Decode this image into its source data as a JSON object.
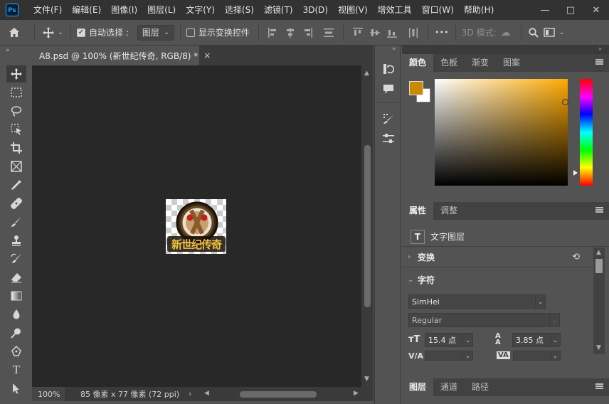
{
  "app": {
    "logo": "Ps"
  },
  "menu": [
    "文件(F)",
    "编辑(E)",
    "图像(I)",
    "图层(L)",
    "文字(Y)",
    "选择(S)",
    "滤镜(T)",
    "3D(D)",
    "视图(V)",
    "增效工具",
    "窗口(W)",
    "帮助(H)"
  ],
  "window": {
    "minimize": "—",
    "maximize": "□",
    "close": "✕"
  },
  "options": {
    "auto_select_label": "自动选择 :",
    "auto_select_checked": true,
    "auto_select_value": "图层",
    "show_transform_label": "显示变换控件",
    "show_transform_checked": false,
    "mode_3d_label": "3D 模式:",
    "more": "•••"
  },
  "document": {
    "tab_title": "A8.psd @ 100% (新世纪传奇, RGB/8) *",
    "close": "×",
    "image_text": "新世纪传奇",
    "zoom": "100%",
    "info": "85 像素 x 77 像素 (72 ppi)"
  },
  "panels": {
    "color_tabs": [
      "颜色",
      "色板",
      "渐变",
      "图案"
    ],
    "properties_tabs": [
      "属性",
      "调整"
    ],
    "layer_kind": "文字图层",
    "transform_title": "变换",
    "character_title": "字符",
    "font_family": "SimHei",
    "font_style": "Regular",
    "font_size": "15.4 点",
    "leading": "3.85 点",
    "kerning_label": "V/A",
    "tracking_label": "VA",
    "layers_tabs": [
      "图层",
      "通道",
      "路径"
    ]
  },
  "colors": {
    "foreground": "#cc8800",
    "background": "#ffffff",
    "hue": "#ffaa00"
  }
}
